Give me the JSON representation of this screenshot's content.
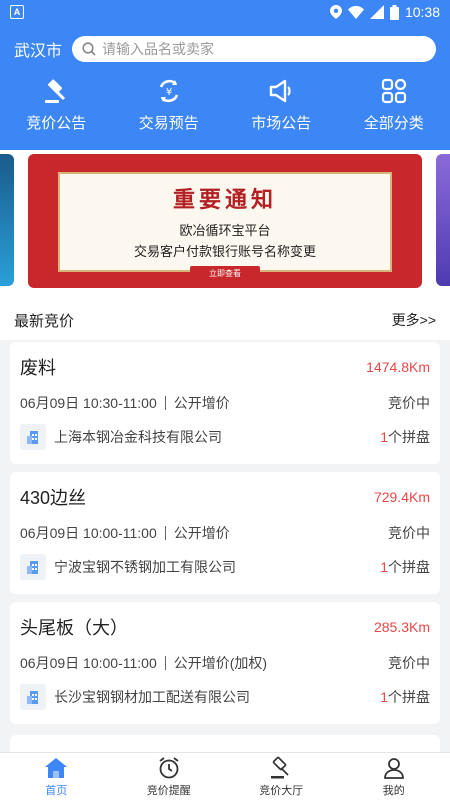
{
  "status_bar": {
    "time": "10:38",
    "left_icon": "A"
  },
  "header": {
    "city": "武汉市",
    "search_placeholder": "请输入品名或卖家"
  },
  "nav": [
    {
      "label": "竞价公告",
      "icon": "gavel-icon"
    },
    {
      "label": "交易预告",
      "icon": "cycle-yuan-icon"
    },
    {
      "label": "市场公告",
      "icon": "megaphone-icon"
    },
    {
      "label": "全部分类",
      "icon": "grid-icon"
    }
  ],
  "banner": {
    "title": "重要通知",
    "line1": "欧冶循环宝平台",
    "line2": "交易客户付款银行账号名称变更",
    "button": "立即查看"
  },
  "section": {
    "title": "最新竞价",
    "more": "更多>>"
  },
  "auctions": [
    {
      "name": "废料",
      "distance": "1474.8Km",
      "date": "06月09日 10:30-11:00",
      "type": "公开增价",
      "status": "竞价中",
      "company": "上海本钢冶金科技有限公司",
      "count_num": "1",
      "count_suffix": "个拼盘"
    },
    {
      "name": "430边丝",
      "distance": "729.4Km",
      "date": "06月09日 10:00-11:00",
      "type": "公开增价",
      "status": "竞价中",
      "company": "宁波宝钢不锈钢加工有限公司",
      "count_num": "1",
      "count_suffix": "个拼盘"
    },
    {
      "name": "头尾板（大）",
      "distance": "285.3Km",
      "date": "06月09日 10:00-11:00",
      "type": "公开增价(加权)",
      "status": "竞价中",
      "company": "长沙宝钢钢材加工配送有限公司",
      "count_num": "1",
      "count_suffix": "个拼盘"
    }
  ],
  "tabbar": [
    {
      "label": "首页",
      "icon": "home-icon",
      "active": true
    },
    {
      "label": "竞价提醒",
      "icon": "alarm-clock-icon",
      "active": false
    },
    {
      "label": "竞价大厅",
      "icon": "auction-hall-icon",
      "active": false
    },
    {
      "label": "我的",
      "icon": "user-icon",
      "active": false
    }
  ],
  "colors": {
    "primary": "#3c87f5",
    "accent_red": "#e84848",
    "banner_red": "#c8282c"
  }
}
